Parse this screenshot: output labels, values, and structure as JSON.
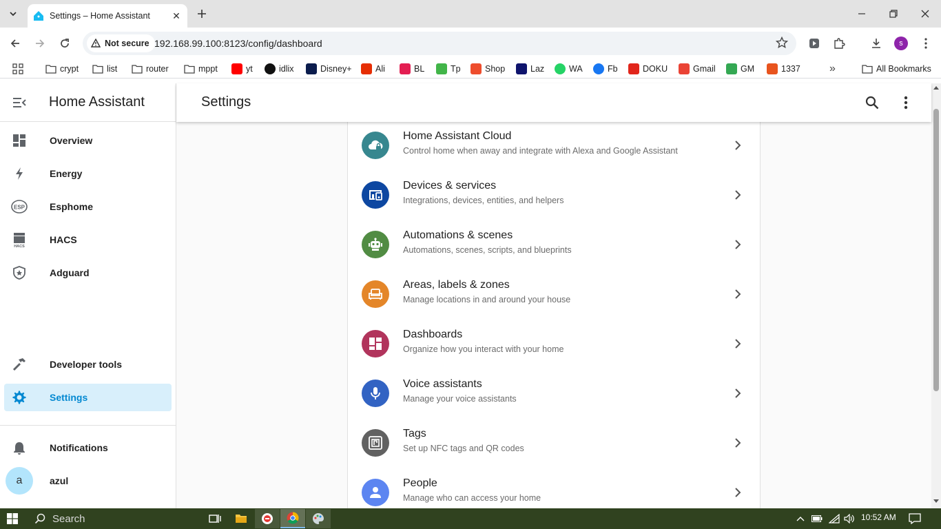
{
  "browser": {
    "tab_title": "Settings – Home Assistant",
    "security_label": "Not secure",
    "url": "192.168.99.100:8123/config/dashboard",
    "profile_initial": "s"
  },
  "bookmarks": [
    {
      "label": "crypt",
      "icon": "folder-icon"
    },
    {
      "label": "list",
      "icon": "folder-icon"
    },
    {
      "label": "router",
      "icon": "folder-icon"
    },
    {
      "label": "mppt",
      "icon": "folder-icon"
    },
    {
      "label": "yt",
      "icon": "youtube-icon",
      "color": "#ff0000"
    },
    {
      "label": "idlix",
      "icon": "idlix-icon",
      "color": "#111111"
    },
    {
      "label": "Disney+",
      "icon": "disney-icon",
      "color": "#0b1c4d"
    },
    {
      "label": "Ali",
      "icon": "aliexpress-icon",
      "color": "#e62e04"
    },
    {
      "label": "BL",
      "icon": "bukalapak-icon",
      "color": "#e31e52"
    },
    {
      "label": "Tp",
      "icon": "tokopedia-icon",
      "color": "#42b549"
    },
    {
      "label": "Shop",
      "icon": "shopee-icon",
      "color": "#ee4d2d"
    },
    {
      "label": "Laz",
      "icon": "lazada-icon",
      "color": "#0f146d"
    },
    {
      "label": "WA",
      "icon": "whatsapp-icon",
      "color": "#25d366"
    },
    {
      "label": "Fb",
      "icon": "facebook-icon",
      "color": "#1877f2"
    },
    {
      "label": "DOKU",
      "icon": "doku-icon",
      "color": "#e1251b"
    },
    {
      "label": "Gmail",
      "icon": "gmail-icon",
      "color": "#ea4335"
    },
    {
      "label": "GM",
      "icon": "google-maps-icon",
      "color": "#34a853"
    },
    {
      "label": "1337",
      "icon": "1337x-icon",
      "color": "#e8541e"
    }
  ],
  "all_bookmarks_label": "All Bookmarks",
  "sidebar": {
    "title": "Home Assistant",
    "items": [
      {
        "label": "Overview",
        "icon": "dashboard-icon"
      },
      {
        "label": "Energy",
        "icon": "lightning-icon"
      },
      {
        "label": "Esphome",
        "icon": "esphome-icon"
      },
      {
        "label": "HACS",
        "icon": "hacs-icon"
      },
      {
        "label": "Adguard",
        "icon": "shield-icon"
      }
    ],
    "developer_tools": "Developer tools",
    "settings": "Settings",
    "notifications": "Notifications",
    "user_initial": "a",
    "user_name": "azul"
  },
  "header": {
    "title": "Settings"
  },
  "settings_rows": [
    {
      "title": "Home Assistant Cloud",
      "subtitle": "Control home when away and integrate with Alexa and Google Assistant",
      "color": "#37878f",
      "icon": "cloud-lock-icon"
    },
    {
      "title": "Devices & services",
      "subtitle": "Integrations, devices, entities, and helpers",
      "color": "#0d47a1",
      "icon": "devices-icon"
    },
    {
      "title": "Automations & scenes",
      "subtitle": "Automations, scenes, scripts, and blueprints",
      "color": "#518c43",
      "icon": "robot-icon"
    },
    {
      "title": "Areas, labels & zones",
      "subtitle": "Manage locations in and around your house",
      "color": "#e48629",
      "icon": "sofa-icon"
    },
    {
      "title": "Dashboards",
      "subtitle": "Organize how you interact with your home",
      "color": "#b1345c",
      "icon": "dashboard-icon"
    },
    {
      "title": "Voice assistants",
      "subtitle": "Manage your voice assistants",
      "color": "#3263c3",
      "icon": "microphone-icon"
    },
    {
      "title": "Tags",
      "subtitle": "Set up NFC tags and QR codes",
      "color": "#616161",
      "icon": "nfc-icon"
    },
    {
      "title": "People",
      "subtitle": "Manage who can access your home",
      "color": "#5c85f1",
      "icon": "account-icon"
    }
  ],
  "taskbar": {
    "search_placeholder": "Search",
    "time": "10:52 AM"
  }
}
